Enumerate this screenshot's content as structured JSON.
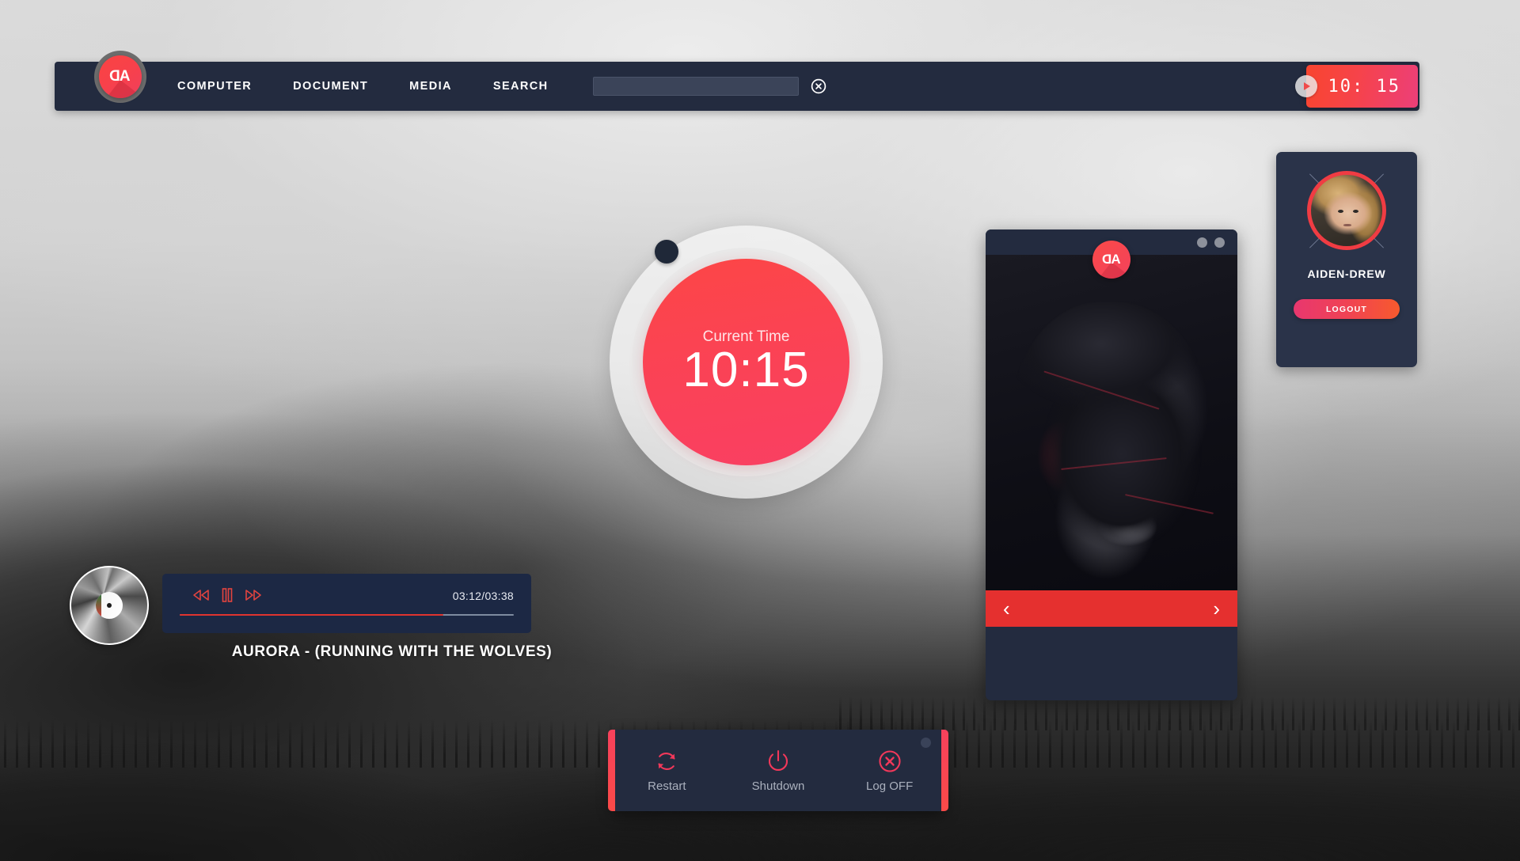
{
  "topbar": {
    "logo_text": "AD",
    "nav_items": [
      {
        "label": "COMPUTER",
        "name": "computer"
      },
      {
        "label": "DOCUMENT",
        "name": "document"
      },
      {
        "label": "MEDIA",
        "name": "media"
      },
      {
        "label": "SEARCH",
        "name": "search"
      }
    ],
    "search": {
      "value": "",
      "placeholder": ""
    },
    "clear_icon": "close-circle-icon",
    "chip_time": "10: 15",
    "chip_play_icon": "play-icon"
  },
  "clock_widget": {
    "label": "Current Time",
    "time": "10:15"
  },
  "media_widget": {
    "badge_text": "AD",
    "prev_label": "‹",
    "next_label": "›",
    "dots": [
      "minimize-dot",
      "maximize-dot"
    ]
  },
  "user_panel": {
    "username": "AIDEN-DREW",
    "logout_label": "LOGOUT"
  },
  "music_player": {
    "track_title": "AURORA - (RUNNING WITH THE WOLVES)",
    "time_display": "03:12/03:38",
    "elapsed": "03:12",
    "duration": "03:38",
    "progress_percent": 79,
    "controls": [
      {
        "name": "rewind",
        "icon": "rewind-icon"
      },
      {
        "name": "pause",
        "icon": "pause-icon"
      },
      {
        "name": "fast-forward",
        "icon": "fast-forward-icon"
      }
    ]
  },
  "power_menu": {
    "items": [
      {
        "label": "Restart",
        "icon": "restart-icon",
        "name": "restart"
      },
      {
        "label": "Shutdown",
        "icon": "power-icon",
        "name": "shutdown"
      },
      {
        "label": "Log OFF",
        "icon": "close-circle-icon",
        "name": "log-off"
      }
    ]
  },
  "colors": {
    "accent_red": "#f9452f",
    "accent_pink": "#ec3f79",
    "panel_navy": "#232b3f",
    "player_navy": "#1c2844",
    "nav_red": "#e5302f"
  }
}
